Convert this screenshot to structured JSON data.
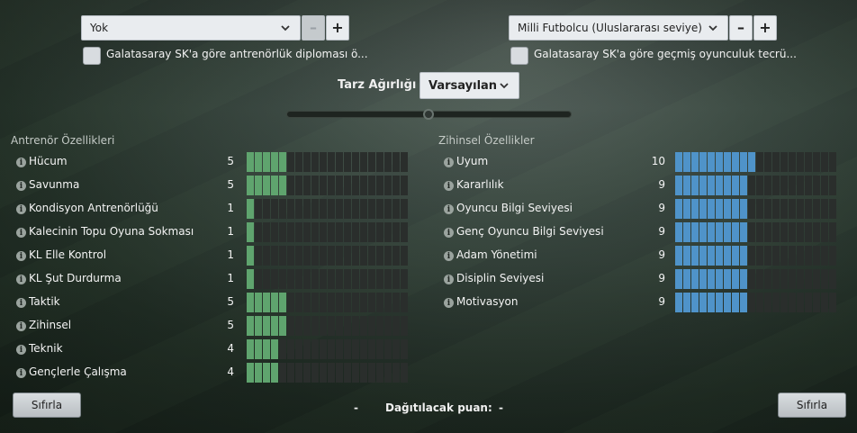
{
  "left_panel": {
    "select_value": "Yok",
    "checkbox_label": "Galatasaray SK'a göre antrenörlük diploması ö..."
  },
  "right_panel": {
    "select_value": "Milli Futbolcu (Uluslararası seviye)",
    "checkbox_label": "Galatasaray SK'a göre geçmiş oyunculuk tecrü..."
  },
  "minus_label": "–",
  "plus_label": "+",
  "style": {
    "label": "Tarz Ağırlığı",
    "select_value": "Varsayılan",
    "slider_value": 0.5
  },
  "coach_attributes": {
    "title": "Antrenör Özellikleri",
    "max": 20,
    "items": [
      {
        "label": "Hücum",
        "value": 5
      },
      {
        "label": "Savunma",
        "value": 5
      },
      {
        "label": "Kondisyon Antrenörlüğü",
        "value": 1
      },
      {
        "label": "Kalecinin Topu Oyuna Sokması",
        "value": 1
      },
      {
        "label": "KL Elle Kontrol",
        "value": 1
      },
      {
        "label": "KL Şut Durdurma",
        "value": 1
      },
      {
        "label": "Taktik",
        "value": 5
      },
      {
        "label": "Zihinsel",
        "value": 5
      },
      {
        "label": "Teknik",
        "value": 4
      },
      {
        "label": "Gençlerle Çalışma",
        "value": 4
      }
    ]
  },
  "mental_attributes": {
    "title": "Zihinsel Özellikler",
    "max": 20,
    "items": [
      {
        "label": "Uyum",
        "value": 10
      },
      {
        "label": "Kararlılık",
        "value": 9
      },
      {
        "label": "Oyuncu Bilgi Seviyesi",
        "value": 9
      },
      {
        "label": "Genç Oyuncu Bilgi Seviyesi",
        "value": 9
      },
      {
        "label": "Adam Yönetimi",
        "value": 9
      },
      {
        "label": "Disiplin Seviyesi",
        "value": 9
      },
      {
        "label": "Motivasyon",
        "value": 9
      }
    ]
  },
  "footer": {
    "reset_left": "Sıfırla",
    "reset_right": "Sıfırla",
    "points_label": "Dağıtılacak puan:",
    "dash_left": "-",
    "dash_right": "-"
  },
  "colors": {
    "coach_bar": "#5fa46e",
    "mental_bar": "#4f93c9",
    "empty_bar": "#2a2e2c"
  },
  "icons": {
    "info": "info-icon",
    "chevron": "chevron-down-icon"
  }
}
